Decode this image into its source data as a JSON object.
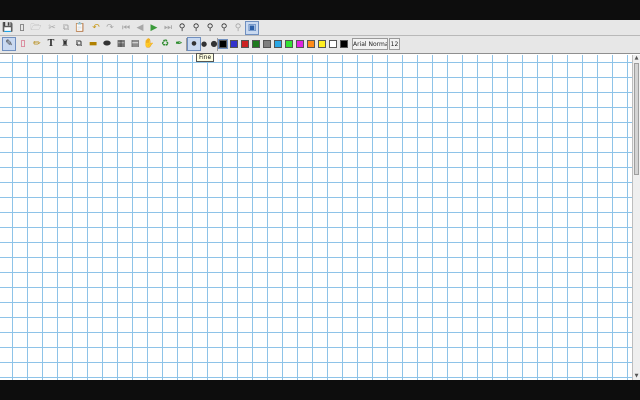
{
  "toolbar_main": {
    "icons": [
      "save-icon",
      "new-page-icon",
      "open-icon",
      "cut-icon",
      "copy-icon",
      "paste-icon",
      "undo-icon",
      "redo-icon",
      "first-page-icon",
      "previous-page-icon",
      "next-page-icon",
      "last-page-icon",
      "zoom-fit-icon",
      "zoom-out-icon",
      "zoom-in-icon",
      "zoom-width-icon",
      "zoom-page-icon",
      "fullscreen-icon"
    ]
  },
  "toolbar_tools": {
    "tools": [
      "pen-icon",
      "eraser-icon",
      "highlighter-icon",
      "text-icon",
      "image-icon",
      "shapes-icon",
      "ruler-icon",
      "select-region-icon",
      "select-rectangle-icon",
      "vertical-space-icon",
      "hand-icon",
      "shape-recognizer-icon",
      "default-pen-icon"
    ],
    "thickness": [
      "fine",
      "medium",
      "thick"
    ],
    "colors": [
      "#000000",
      "#3333cc",
      "#cc2222",
      "#1f7a1f",
      "#808080",
      "#2aa7e6",
      "#33e033",
      "#e024e0",
      "#ff8c1a",
      "#ffee22",
      "#ffffff",
      "#000000"
    ],
    "font_name": "Arial Normal",
    "font_size": "12"
  },
  "tooltip": "Fine"
}
